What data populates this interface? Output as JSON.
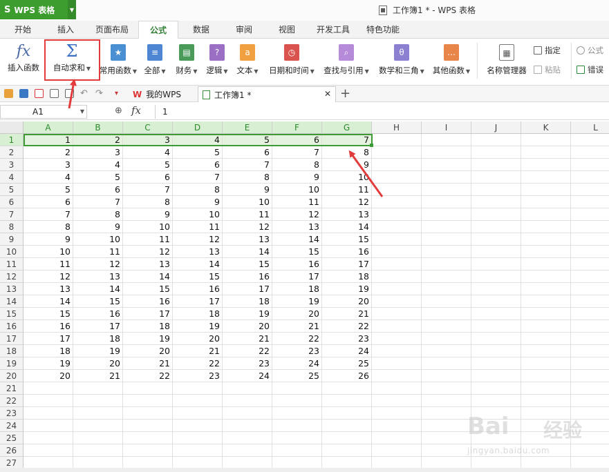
{
  "app": {
    "name": "WPS 表格",
    "logo": "S",
    "window_title": "工作簿1 * - WPS 表格"
  },
  "menu_tabs": [
    "开始",
    "插入",
    "页面布局",
    "公式",
    "数据",
    "审阅",
    "视图",
    "开发工具",
    "特色功能"
  ],
  "active_tab": "公式",
  "ribbon": {
    "insert_function": "插入函数",
    "autosum": "自动求和",
    "common": "常用函数",
    "all": "全部",
    "finance": "财务",
    "logic": "逻辑",
    "text": "文本",
    "datetime": "日期和时间",
    "lookup": "查找与引用",
    "math": "数学和三角",
    "other": "其他函数",
    "name_manager": "名称管理器",
    "assign": "指定",
    "paste": "粘贴",
    "formula_audit": "公式",
    "error_check": "错误"
  },
  "doc_tabs": {
    "wps": "我的WPS",
    "book": "工作簿1 *"
  },
  "formula_bar": {
    "name_box": "A1",
    "value": "1"
  },
  "columns": [
    "A",
    "B",
    "C",
    "D",
    "E",
    "F",
    "G",
    "H",
    "I",
    "J",
    "K",
    "L"
  ],
  "row_count": 27,
  "selected_row": 1,
  "cells": [
    [
      1,
      2,
      3,
      4,
      5,
      6,
      7
    ],
    [
      2,
      3,
      4,
      5,
      6,
      7,
      8
    ],
    [
      3,
      4,
      5,
      6,
      7,
      8,
      9
    ],
    [
      4,
      5,
      6,
      7,
      8,
      9,
      10
    ],
    [
      5,
      6,
      7,
      8,
      9,
      10,
      11
    ],
    [
      6,
      7,
      8,
      9,
      10,
      11,
      12
    ],
    [
      7,
      8,
      9,
      10,
      11,
      12,
      13
    ],
    [
      8,
      9,
      10,
      11,
      12,
      13,
      14
    ],
    [
      9,
      10,
      11,
      12,
      13,
      14,
      15
    ],
    [
      10,
      11,
      12,
      13,
      14,
      15,
      16
    ],
    [
      11,
      12,
      13,
      14,
      15,
      16,
      17
    ],
    [
      12,
      13,
      14,
      15,
      16,
      17,
      18
    ],
    [
      13,
      14,
      15,
      16,
      17,
      18,
      19
    ],
    [
      14,
      15,
      16,
      17,
      18,
      19,
      20
    ],
    [
      15,
      16,
      17,
      18,
      19,
      20,
      21
    ],
    [
      16,
      17,
      18,
      19,
      20,
      21,
      22
    ],
    [
      17,
      18,
      19,
      20,
      21,
      22,
      23
    ],
    [
      18,
      19,
      20,
      21,
      22,
      23,
      24
    ],
    [
      19,
      20,
      21,
      22,
      23,
      24,
      25
    ],
    [
      20,
      21,
      22,
      23,
      24,
      25,
      26
    ]
  ],
  "watermark": {
    "brand": "Bai",
    "site": "经验",
    "url": "jingyan.baidu.com"
  },
  "colors": {
    "accent": "#3c9c2e",
    "selection": "#3d9b35",
    "annotation": "#e33b3b"
  }
}
